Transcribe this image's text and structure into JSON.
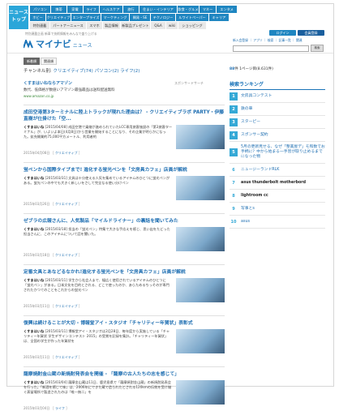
{
  "site": {
    "logo": [
      "ニュース",
      "トップ"
    ],
    "nav_row1": [
      "パソコン",
      "携帯",
      "家電",
      "ライフ",
      "ヘルスケア",
      "旅行",
      "住まい・インテリア",
      "飲食・グルメ",
      "マネー",
      "エンタメ"
    ],
    "nav_row2": [
      "ホビー",
      "クリエイティブ",
      "エンタープライズ",
      "マーケティング",
      "開発・SE",
      "テクノロジー",
      "ルワイトペーパー",
      "キャリア"
    ],
    "nav_row3": [
      "特別連載",
      "パートナーニュース",
      "スマホ",
      "製品情報",
      "新製品プレゼント",
      "Q&A",
      "wiki",
      "ショッピング"
    ]
  },
  "header": {
    "brand_name": "マイナビ",
    "brand_sub": "ニュース",
    "breadcrumb": "特別連載企画 新車で技術情報をみんなで盛り上げる",
    "login": "ログイン",
    "register": "会員登録",
    "mini_links": "新入会登録 ｜ アプリ ｜ 検索 ｜ 記事一覧 ｜ 関連",
    "search_button": "検索"
  },
  "tabs": [
    "新着順",
    "関連順"
  ],
  "categories": {
    "label": "チャンネル別:",
    "items": [
      "クリエイティブ(74)",
      "パソコン(2)",
      "ライフ(2)"
    ]
  },
  "pager": {
    "text": "件 1ページ目(8.631件)",
    "count": "88"
  },
  "ad": {
    "title": "くすまはいねならアマゾン",
    "desc": "数代、低価格が数値いアマゾン最強最品は送料配送無料",
    "url": "www.amazon.co.jp",
    "tag": "スポンサードサーチ"
  },
  "articles": [
    {
      "title": "成田空港第3ターミナルに陸上トラックが現れた理由は？ - クリエイティブラボ PARTY・伊藤直樹が仕掛けた「空...",
      "author": "くすまはいね",
      "body": "[2015/04/08] 成田空港で乗継が進められていたLCC専用旅客施設の「第3旅客ターミナル」が、いよいよ本日(4月8日)から営業を開始することになり、その企業が明らかになった。拡充開業約75,000平方メートル、利用者約",
      "date": "2015年04月08日",
      "tag": "クリエイティブ"
    },
    {
      "title": "蛍ペンから国際タイプまで! 進化する蛍光ペンを「文房具カフェ」店員が解説",
      "author": "くすまはいね",
      "body": "[2015/03/31] 文具は十分使える人気を集めているアイテムのひとつに蛍光ペンがある。蛍光ペンの中でも大きく新しいをさして完全なる使い分けペン",
      "date": "2015年03月26日",
      "tag": "クリエイティブ"
    },
    {
      "title": "ゼブラの広報さんに、人気製品「マイルドライナー」の裏話を聞いてみた",
      "author": "くすまはいね",
      "body": "[2015/03/18] 担当の「蛍光ペン」特集で大きな手応えを感じ、思い出をたどった担当さんに、このアイテムについて話を聞いた。",
      "date": "2015年03月18日",
      "tag": "クリエイティブ"
    },
    {
      "title": "定番文具とあなどるなかれ!進化する蛍光ペンを「文房具カフェ」店員が解説",
      "author": "くすまはいね",
      "body": "[2015/03/11] 学生から社会人まで、幅広く使用されているアイテムのひとつに「蛍光ペン」がある。日本文化を目的とされる、どこで使ったのか、あらためるちっそのが専門されたかつてのことをこれからの蛍光ペン",
      "date": "2015年03月11日",
      "tag": "クリエイティブ"
    },
    {
      "title": "復興は続けることが大切 - 博報堂アイ・スタジオ「チャリティー年賀状」表彰式",
      "author": "くすまはいね",
      "body": "[2015/03/11] 博報堂アイ・スタジオは2月28日、毎年度から実施している「チャリティー年賀状 学生デザインコンテスト 2015」の受賞を記録を集計。「チャリティー年賀状」は、全国の学生が作った年賀状を",
      "date": "2015年03月11日",
      "tag": "クリエイティブ"
    },
    {
      "title": "薩摩焼酎金山蔵の新焼酎発表会を開催 - 「薩摩の古人たちの志を感じて」",
      "author": "くすまはいね",
      "body": "[2015/03/04] 薩摩金山蔵は11日、鹿児島県で「薩摩焼酎金山蔵」の新焼酎発表会を行った。「新酒を感じて味」は、2006年にできた蔵で造られたとされる120kmの伝統を受け継ぐ蒸留場所で製造されたのは「唯一無二」を",
      "date": "2015年03月04日",
      "tag": "ライフ"
    }
  ],
  "ranking": {
    "title": "検索ランキング",
    "items": [
      "文房具コンテスト",
      "鉄の車",
      "スターピー",
      "スポンサー契約",
      "5月の更新見せる、なぜ「整美屋デ」モ和数でお手柄に？中から始まる一手習が取り止めるまでになった物",
      "ニュージーランドRLK",
      "asus thunderbolt motherbord",
      "lightroom cc",
      "写事とs",
      "asus"
    ]
  },
  "colors": {
    "accent": "#1f86c1",
    "link": "#1f6fb2",
    "rank": "#35a9d6"
  }
}
